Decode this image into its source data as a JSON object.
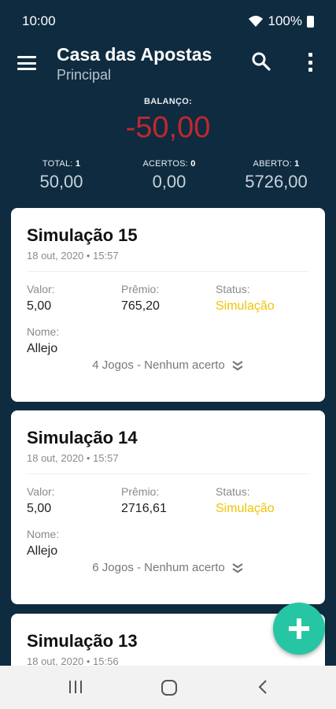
{
  "status_bar": {
    "time": "10:00",
    "battery": "100%"
  },
  "app_bar": {
    "title": "Casa das Apostas",
    "subtitle": "Principal"
  },
  "summary": {
    "balance_label": "BALANÇO:",
    "balance_value": "-50,00",
    "stats": [
      {
        "label": "TOTAL:",
        "count": "1",
        "value": "50,00"
      },
      {
        "label": "ACERTOS:",
        "count": "0",
        "value": "0,00"
      },
      {
        "label": "ABERTO:",
        "count": "1",
        "value": "5726,00"
      }
    ]
  },
  "bets": [
    {
      "title": "Simulação 15",
      "date": "18 out, 2020 • 15:57",
      "valor_label": "Valor:",
      "valor": "5,00",
      "premio_label": "Prêmio:",
      "premio": "765,20",
      "status_label": "Status:",
      "status": "Simulação",
      "nome_label": "Nome:",
      "nome": "Allejo",
      "footer": "4 Jogos - Nenhum acerto"
    },
    {
      "title": "Simulação 14",
      "date": "18 out, 2020 • 15:57",
      "valor_label": "Valor:",
      "valor": "5,00",
      "premio_label": "Prêmio:",
      "premio": "2716,61",
      "status_label": "Status:",
      "status": "Simulação",
      "nome_label": "Nome:",
      "nome": "Allejo",
      "footer": "6 Jogos - Nenhum acerto"
    },
    {
      "title": "Simulação 13",
      "date": "18 out, 2020 • 15:56"
    }
  ],
  "colors": {
    "background": "#0f2b40",
    "balance_negative": "#c0282e",
    "status_yellow": "#f0c400",
    "fab": "#26c6a4"
  }
}
